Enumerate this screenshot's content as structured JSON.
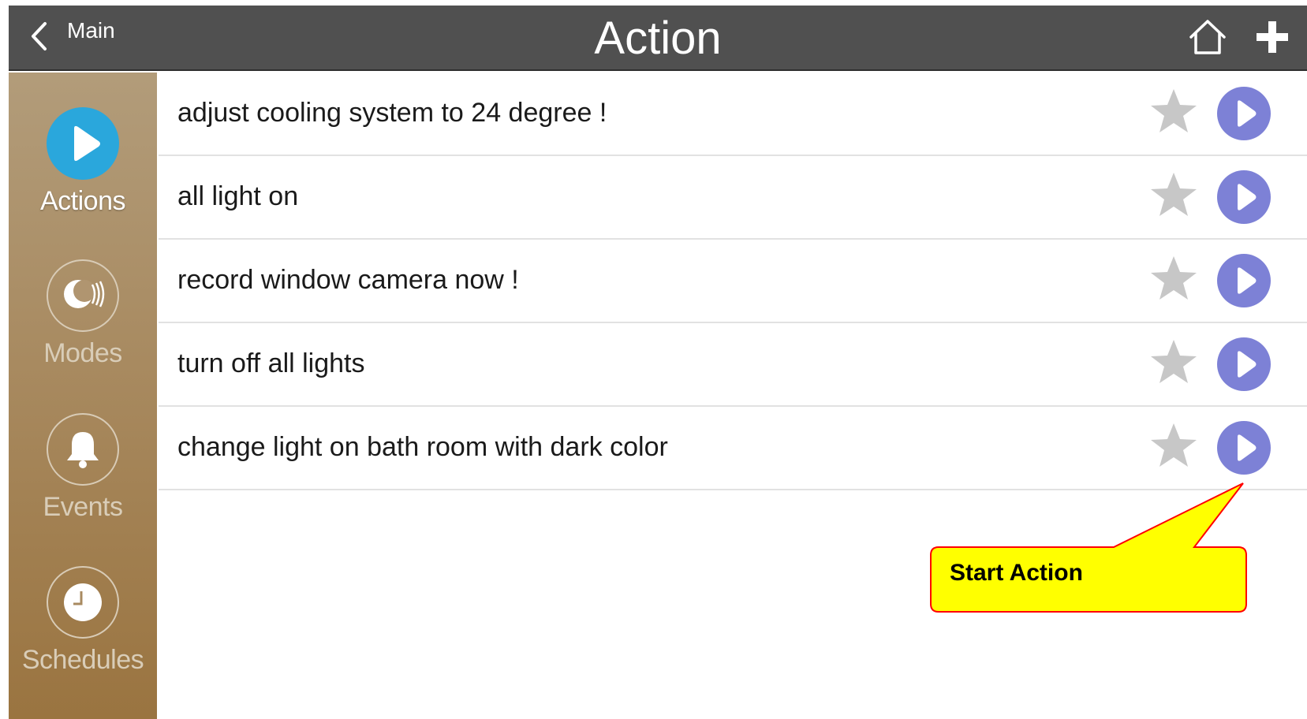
{
  "header": {
    "back_label": "Main",
    "title": "Action",
    "home_icon": "home-icon",
    "add_icon": "plus-icon",
    "background": "#505050"
  },
  "sidebar": {
    "items": [
      {
        "label": "Actions",
        "icon": "play-icon",
        "active": true
      },
      {
        "label": "Modes",
        "icon": "moon-icon",
        "active": false
      },
      {
        "label": "Events",
        "icon": "bell-icon",
        "active": false
      },
      {
        "label": "Schedules",
        "icon": "clock-icon",
        "active": false
      }
    ],
    "active_color": "#2aa7dc"
  },
  "actions": [
    {
      "label": "adjust cooling system to 24 degree !"
    },
    {
      "label": "all light on"
    },
    {
      "label": "record window camera now !"
    },
    {
      "label": "turn off all lights"
    },
    {
      "label": "change light on bath room with dark color"
    }
  ],
  "row_icons": {
    "favorite": "star-icon",
    "run": "play-circle-icon",
    "run_color": "#7d81d6"
  },
  "callout": {
    "text": "Start Action",
    "fill": "#ffff00",
    "border": "#ff0000"
  }
}
